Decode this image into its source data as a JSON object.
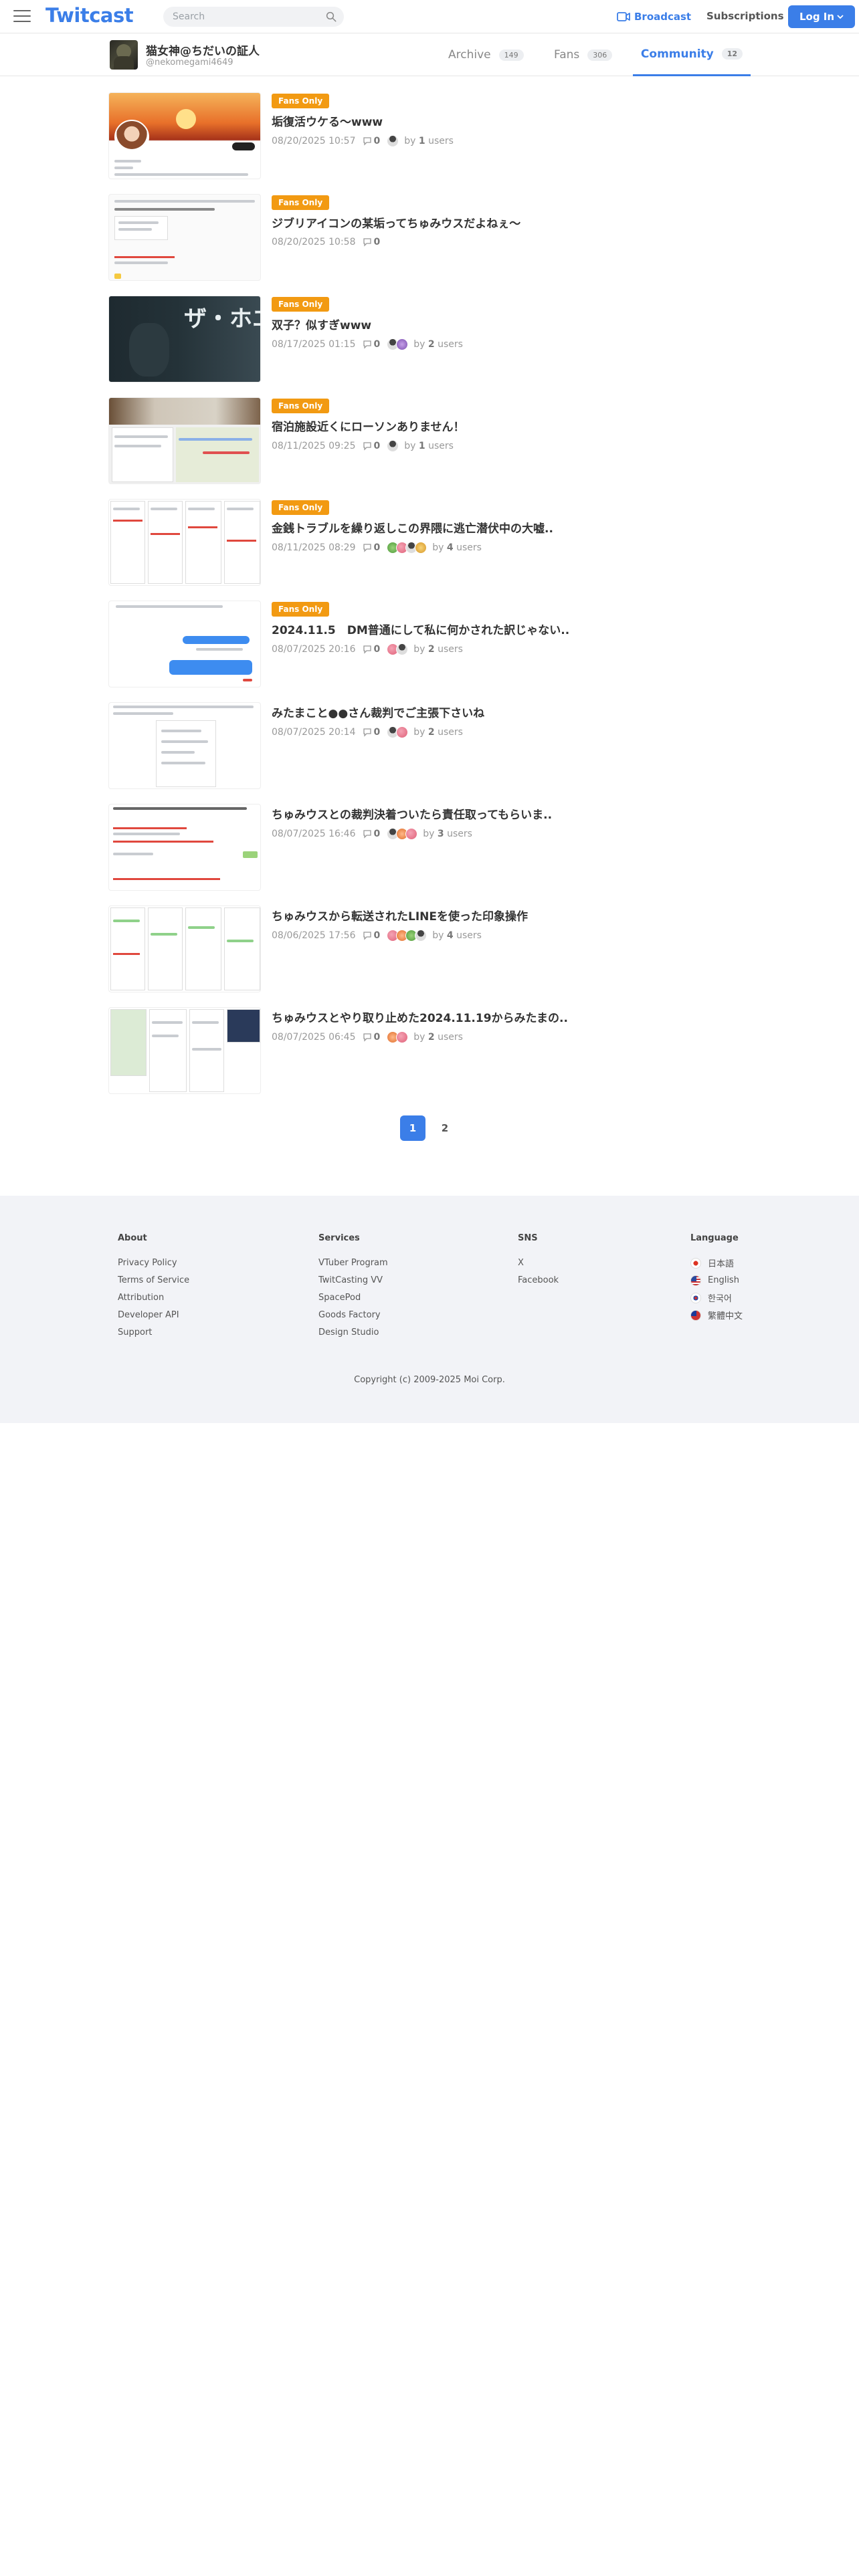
{
  "header": {
    "logo": "Twitcast",
    "search_placeholder": "Search",
    "broadcast": "Broadcast",
    "subscriptions": "Subscriptions",
    "login": "Log In"
  },
  "profile": {
    "name": "猫女神@ちだいの証人",
    "handle": "@nekomegami4649",
    "tabs": [
      {
        "label": "Archive",
        "count": "149"
      },
      {
        "label": "Fans",
        "count": "306"
      },
      {
        "label": "Community",
        "count": "12"
      }
    ]
  },
  "posts": [
    {
      "badge": "Fans Only",
      "title": "垢復活ウケる〜www",
      "date": "08/20/2025 10:57",
      "comments": "0",
      "by": "by",
      "users_count": "1",
      "users_label": "users"
    },
    {
      "badge": "Fans Only",
      "title": "ジブリアイコンの某垢ってちゅみウスだよねぇ〜",
      "date": "08/20/2025 10:58",
      "comments": "0"
    },
    {
      "badge": "Fans Only",
      "title": "双子？似すぎwww",
      "date": "08/17/2025 01:15",
      "comments": "0",
      "by": "by",
      "users_count": "2",
      "users_label": "users"
    },
    {
      "badge": "Fans Only",
      "title": "宿泊施設近くにローソンありません！",
      "date": "08/11/2025 09:25",
      "comments": "0",
      "by": "by",
      "users_count": "1",
      "users_label": "users"
    },
    {
      "badge": "Fans Only",
      "title": "金銭トラブルを繰り返しこの界隈に逃亡潜伏中の大嘘..",
      "date": "08/11/2025 08:29",
      "comments": "0",
      "by": "by",
      "users_count": "4",
      "users_label": "users"
    },
    {
      "badge": "Fans Only",
      "title": "2024.11.5　DM普通にして私に何かされた訳じゃない..",
      "date": "08/07/2025 20:16",
      "comments": "0",
      "by": "by",
      "users_count": "2",
      "users_label": "users"
    },
    {
      "title": "みたまこと●●さん裁判でご主張下さいね",
      "date": "08/07/2025 20:14",
      "comments": "0",
      "by": "by",
      "users_count": "2",
      "users_label": "users"
    },
    {
      "title": "ちゅみウスとの裁判決着ついたら責任取ってもらいま..",
      "date": "08/07/2025 16:46",
      "comments": "0",
      "by": "by",
      "users_count": "3",
      "users_label": "users"
    },
    {
      "title": "ちゅみウスから転送されたLINEを使った印象操作",
      "date": "08/06/2025 17:56",
      "comments": "0",
      "by": "by",
      "users_count": "4",
      "users_label": "users"
    },
    {
      "title": "ちゅみウスとやり取り止めた2024.11.19からみたまの..",
      "date": "08/07/2025 06:45",
      "comments": "0",
      "by": "by",
      "users_count": "2",
      "users_label": "users"
    }
  ],
  "thumbnail_text": {
    "dark": "ザ・ホエ"
  },
  "pagination": [
    "1",
    "2"
  ],
  "footer": {
    "about": {
      "title": "About",
      "links": [
        "Privacy Policy",
        "Terms of Service",
        "Attribution",
        "Developer API",
        "Support"
      ]
    },
    "services": {
      "title": "Services",
      "links": [
        "VTuber Program",
        "TwitCasting VV",
        "SpacePod",
        "Goods Factory",
        "Design Studio"
      ]
    },
    "sns": {
      "title": "SNS",
      "links": [
        "X",
        "Facebook"
      ]
    },
    "language": {
      "title": "Language",
      "links": [
        "日本語",
        "English",
        "한국어",
        "繁體中文"
      ]
    },
    "copyright": "Copyright (c) 2009-2025 Moi Corp."
  },
  "colors": {
    "accent": "#3b7ee8",
    "badge": "#f29a12"
  }
}
